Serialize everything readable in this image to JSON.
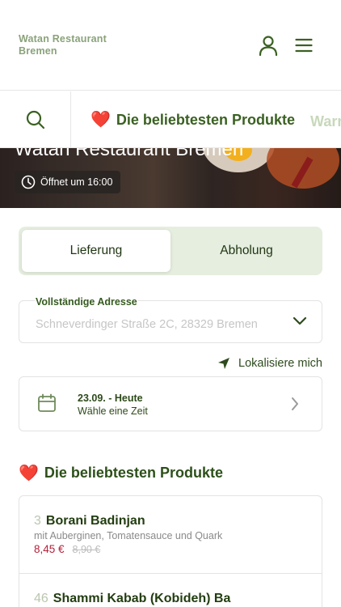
{
  "header": {
    "brand_line1": "Watan Restaurant",
    "brand_line2": "Bremen",
    "user_icon": "user-icon",
    "menu_icon": "hamburger-menu-icon"
  },
  "category_bar": {
    "search_icon": "search-icon",
    "active_category": {
      "emoji": "❤️",
      "label": "Die beliebtesten Produkte"
    },
    "next_category_partial": "Warm"
  },
  "hero": {
    "title": "Watan Restaurant Bremen",
    "opening_status": "Öffnet um 16:00",
    "clock_icon": "clock-icon"
  },
  "order_mode": {
    "options": [
      "Lieferung",
      "Abholung"
    ],
    "selected": "Lieferung"
  },
  "address": {
    "label": "Vollständige Adresse",
    "value": "Schneverdinger Straße 2C, 28329 Bremen",
    "chevron_icon": "chevron-down-icon"
  },
  "locate": {
    "label": "Lokalisiere mich",
    "icon": "location-arrow-icon"
  },
  "time_selector": {
    "date_line": "23.09. - Heute",
    "hint": "Wähle eine Zeit",
    "calendar_icon": "calendar-icon",
    "arrow_icon": "chevron-right-icon"
  },
  "section": {
    "emoji": "❤️",
    "title": "Die beliebtesten Produkte"
  },
  "products": [
    {
      "number": "3",
      "name": "Borani Badinjan",
      "description": "mit Auberginen, Tomatensauce und Quark",
      "price": "8,45 €",
      "old_price": "8,90 €"
    },
    {
      "number": "46",
      "name": "Shammi Kabab (Kobideh) Ba",
      "description": "",
      "price": "",
      "old_price": ""
    }
  ],
  "colors": {
    "brand_green": "#3b6122",
    "light_green": "#e6eedf",
    "price_red": "#b3223a",
    "heart_red": "#d8192b"
  }
}
